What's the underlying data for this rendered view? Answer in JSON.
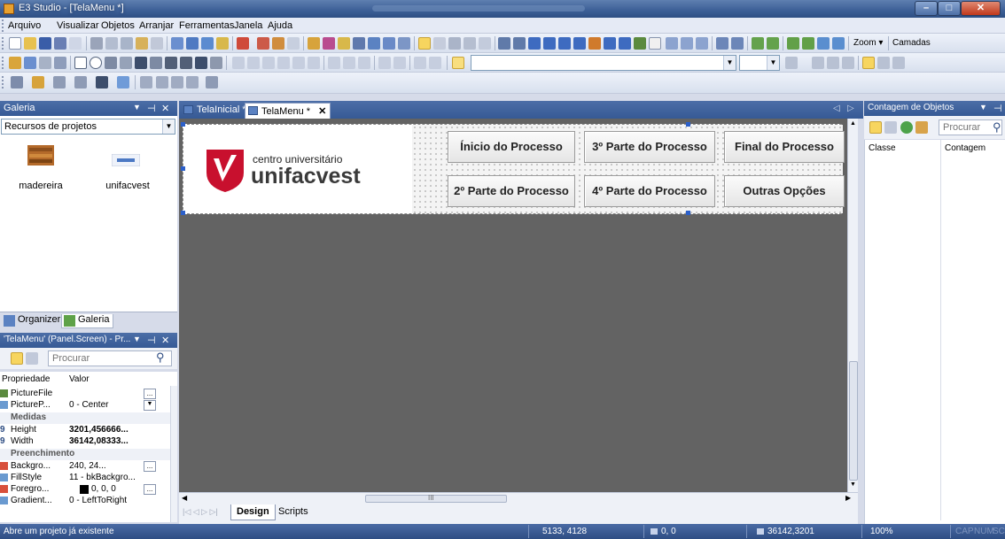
{
  "window": {
    "title": "E3 Studio - [TelaMenu *]",
    "min_glyph": "–",
    "max_glyph": "□",
    "close_glyph": "✕"
  },
  "menu": [
    "Arquivo",
    "Visualizar",
    "Objetos",
    "Arranjar",
    "Ferramentas",
    "Janela",
    "Ajuda"
  ],
  "toolbar": {
    "zoom_label": "Zoom ▾",
    "layers_label": "Camadas"
  },
  "gallery": {
    "title": "Galeria",
    "dropdown_value": "Recursos de projetos",
    "items": [
      {
        "label": "madereira"
      },
      {
        "label": "unifacvest"
      }
    ],
    "bottom_tabs": [
      "Organizer",
      "Galeria"
    ]
  },
  "properties": {
    "title": "'TelaMenu' (Panel.Screen) - Pr...",
    "search_placeholder": "Procurar",
    "col_property": "Propriedade",
    "col_value": "Valor",
    "rows": [
      {
        "name": "PictureFile",
        "value": ""
      },
      {
        "name": "PictureP...",
        "value": "0 - Center"
      },
      {
        "category": "Medidas"
      },
      {
        "name": "Height",
        "value": "3201,456666..."
      },
      {
        "name": "Width",
        "value": "36142,08333..."
      },
      {
        "category": "Preenchimento"
      },
      {
        "name": "Backgro...",
        "value": "240, 24..."
      },
      {
        "name": "FillStyle",
        "value": "11 - bkBackgro..."
      },
      {
        "name": "Foregro...",
        "value": "0, 0, 0"
      },
      {
        "name": "Gradient...",
        "value": "0 - LeftToRight"
      }
    ]
  },
  "doc_tabs": [
    {
      "label": "TelaInicial *"
    },
    {
      "label": "TelaMenu *"
    }
  ],
  "canvas": {
    "logo_small": "centro universitário",
    "logo_big": "unifacvest",
    "buttons": [
      "Ínicio do Processo",
      "3º Parte do Processo",
      "Final do Processo",
      "2º Parte do Processo",
      "4º Parte do Processo",
      "Outras Opções"
    ],
    "hscroll_marker": "III"
  },
  "design_tabs": [
    "Design",
    "Scripts"
  ],
  "objects_panel": {
    "title": "Contagem de Objetos",
    "search_placeholder": "Procurar",
    "col_class": "Classe",
    "col_count": "Contagem"
  },
  "status": {
    "message": "Abre um projeto já existente",
    "cursor": "5133, 4128",
    "offset": "0, 0",
    "size": "36142,3201",
    "zoom": "100%",
    "caps": "CAP",
    "num": "NUM",
    "scrl": "SCRL"
  },
  "colors": {
    "accent": "#3c5f96",
    "canvas": "#636363",
    "logo_red": "#c8102e"
  }
}
